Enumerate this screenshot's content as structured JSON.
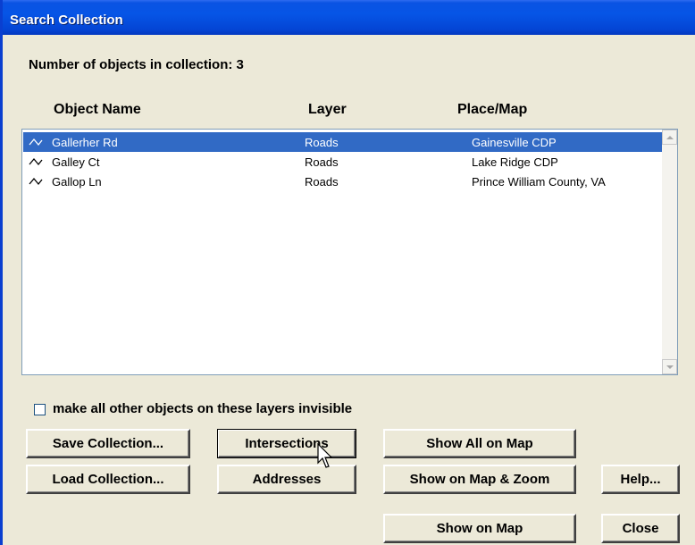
{
  "window": {
    "title": "Search Collection"
  },
  "collection": {
    "count_label": "Number of objects in collection:  3"
  },
  "table": {
    "columns": [
      "Object Name",
      "Layer",
      "Place/Map"
    ],
    "rows": [
      {
        "name": "Gallerher Rd",
        "layer": "Roads",
        "place": "Gainesville CDP",
        "icon": "road-line-icon",
        "selected": true
      },
      {
        "name": "Galley Ct",
        "layer": "Roads",
        "place": "Lake Ridge CDP",
        "icon": "road-line-icon",
        "selected": false
      },
      {
        "name": "Gallop Ln",
        "layer": "Roads",
        "place": "Prince William County, VA",
        "icon": "road-line-icon",
        "selected": false
      }
    ]
  },
  "options": {
    "invisible_label": "make all other objects on these layers invisible",
    "invisible_checked": false
  },
  "buttons": {
    "save_collection": "Save Collection...",
    "load_collection": "Load Collection...",
    "intersections": "Intersections",
    "addresses": "Addresses",
    "show_all_on_map": "Show All on Map",
    "show_on_map_zoom": "Show on Map & Zoom",
    "show_on_map": "Show on Map",
    "help": "Help...",
    "close": "Close"
  },
  "colors": {
    "titlebar": "#0a53e3",
    "selection": "#316ac5",
    "dialog_bg": "#ece9d8"
  }
}
